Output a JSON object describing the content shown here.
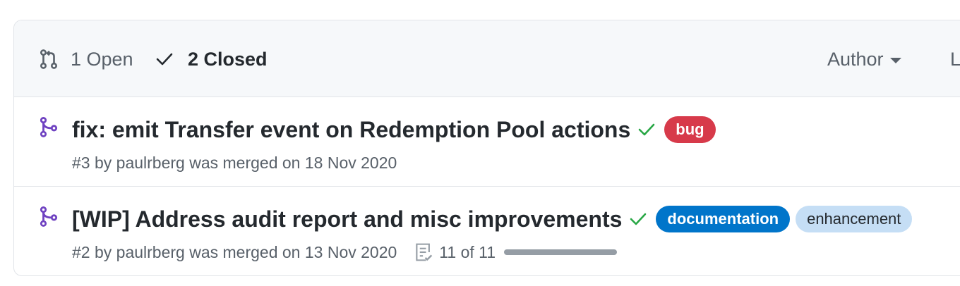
{
  "header": {
    "open_count_label": "1 Open",
    "closed_count_label": "2 Closed",
    "author_filter_label": "Author",
    "label_filter_label": "Label"
  },
  "pull_requests": [
    {
      "title": "fix: emit Transfer event on Redemption Pool actions",
      "meta": "#3 by paulrberg was merged on 18 Nov 2020",
      "labels": [
        {
          "name": "bug",
          "bg": "#d73a4a",
          "fg": "#ffffff"
        }
      ],
      "checklist": null
    },
    {
      "title": "[WIP] Address audit report and misc improvements",
      "meta": "#2 by paulrberg was merged on 13 Nov 2020",
      "labels": [
        {
          "name": "documentation",
          "bg": "#0075ca",
          "fg": "#ffffff"
        },
        {
          "name": "enhancement",
          "bg": "#c5def5",
          "fg": "#24292e"
        }
      ],
      "checklist": {
        "label": "11 of 11",
        "progress": 1.0
      }
    }
  ],
  "colors": {
    "merged_purple": "#6f42c1",
    "check_green": "#28a745",
    "muted_text": "#586069",
    "progress_gray": "#959da5"
  },
  "icons": {
    "open_state": "git-pull-request-icon",
    "closed_state": "check-icon",
    "merged": "git-merge-icon",
    "status_success": "check-icon",
    "checklist": "checklist-icon"
  }
}
